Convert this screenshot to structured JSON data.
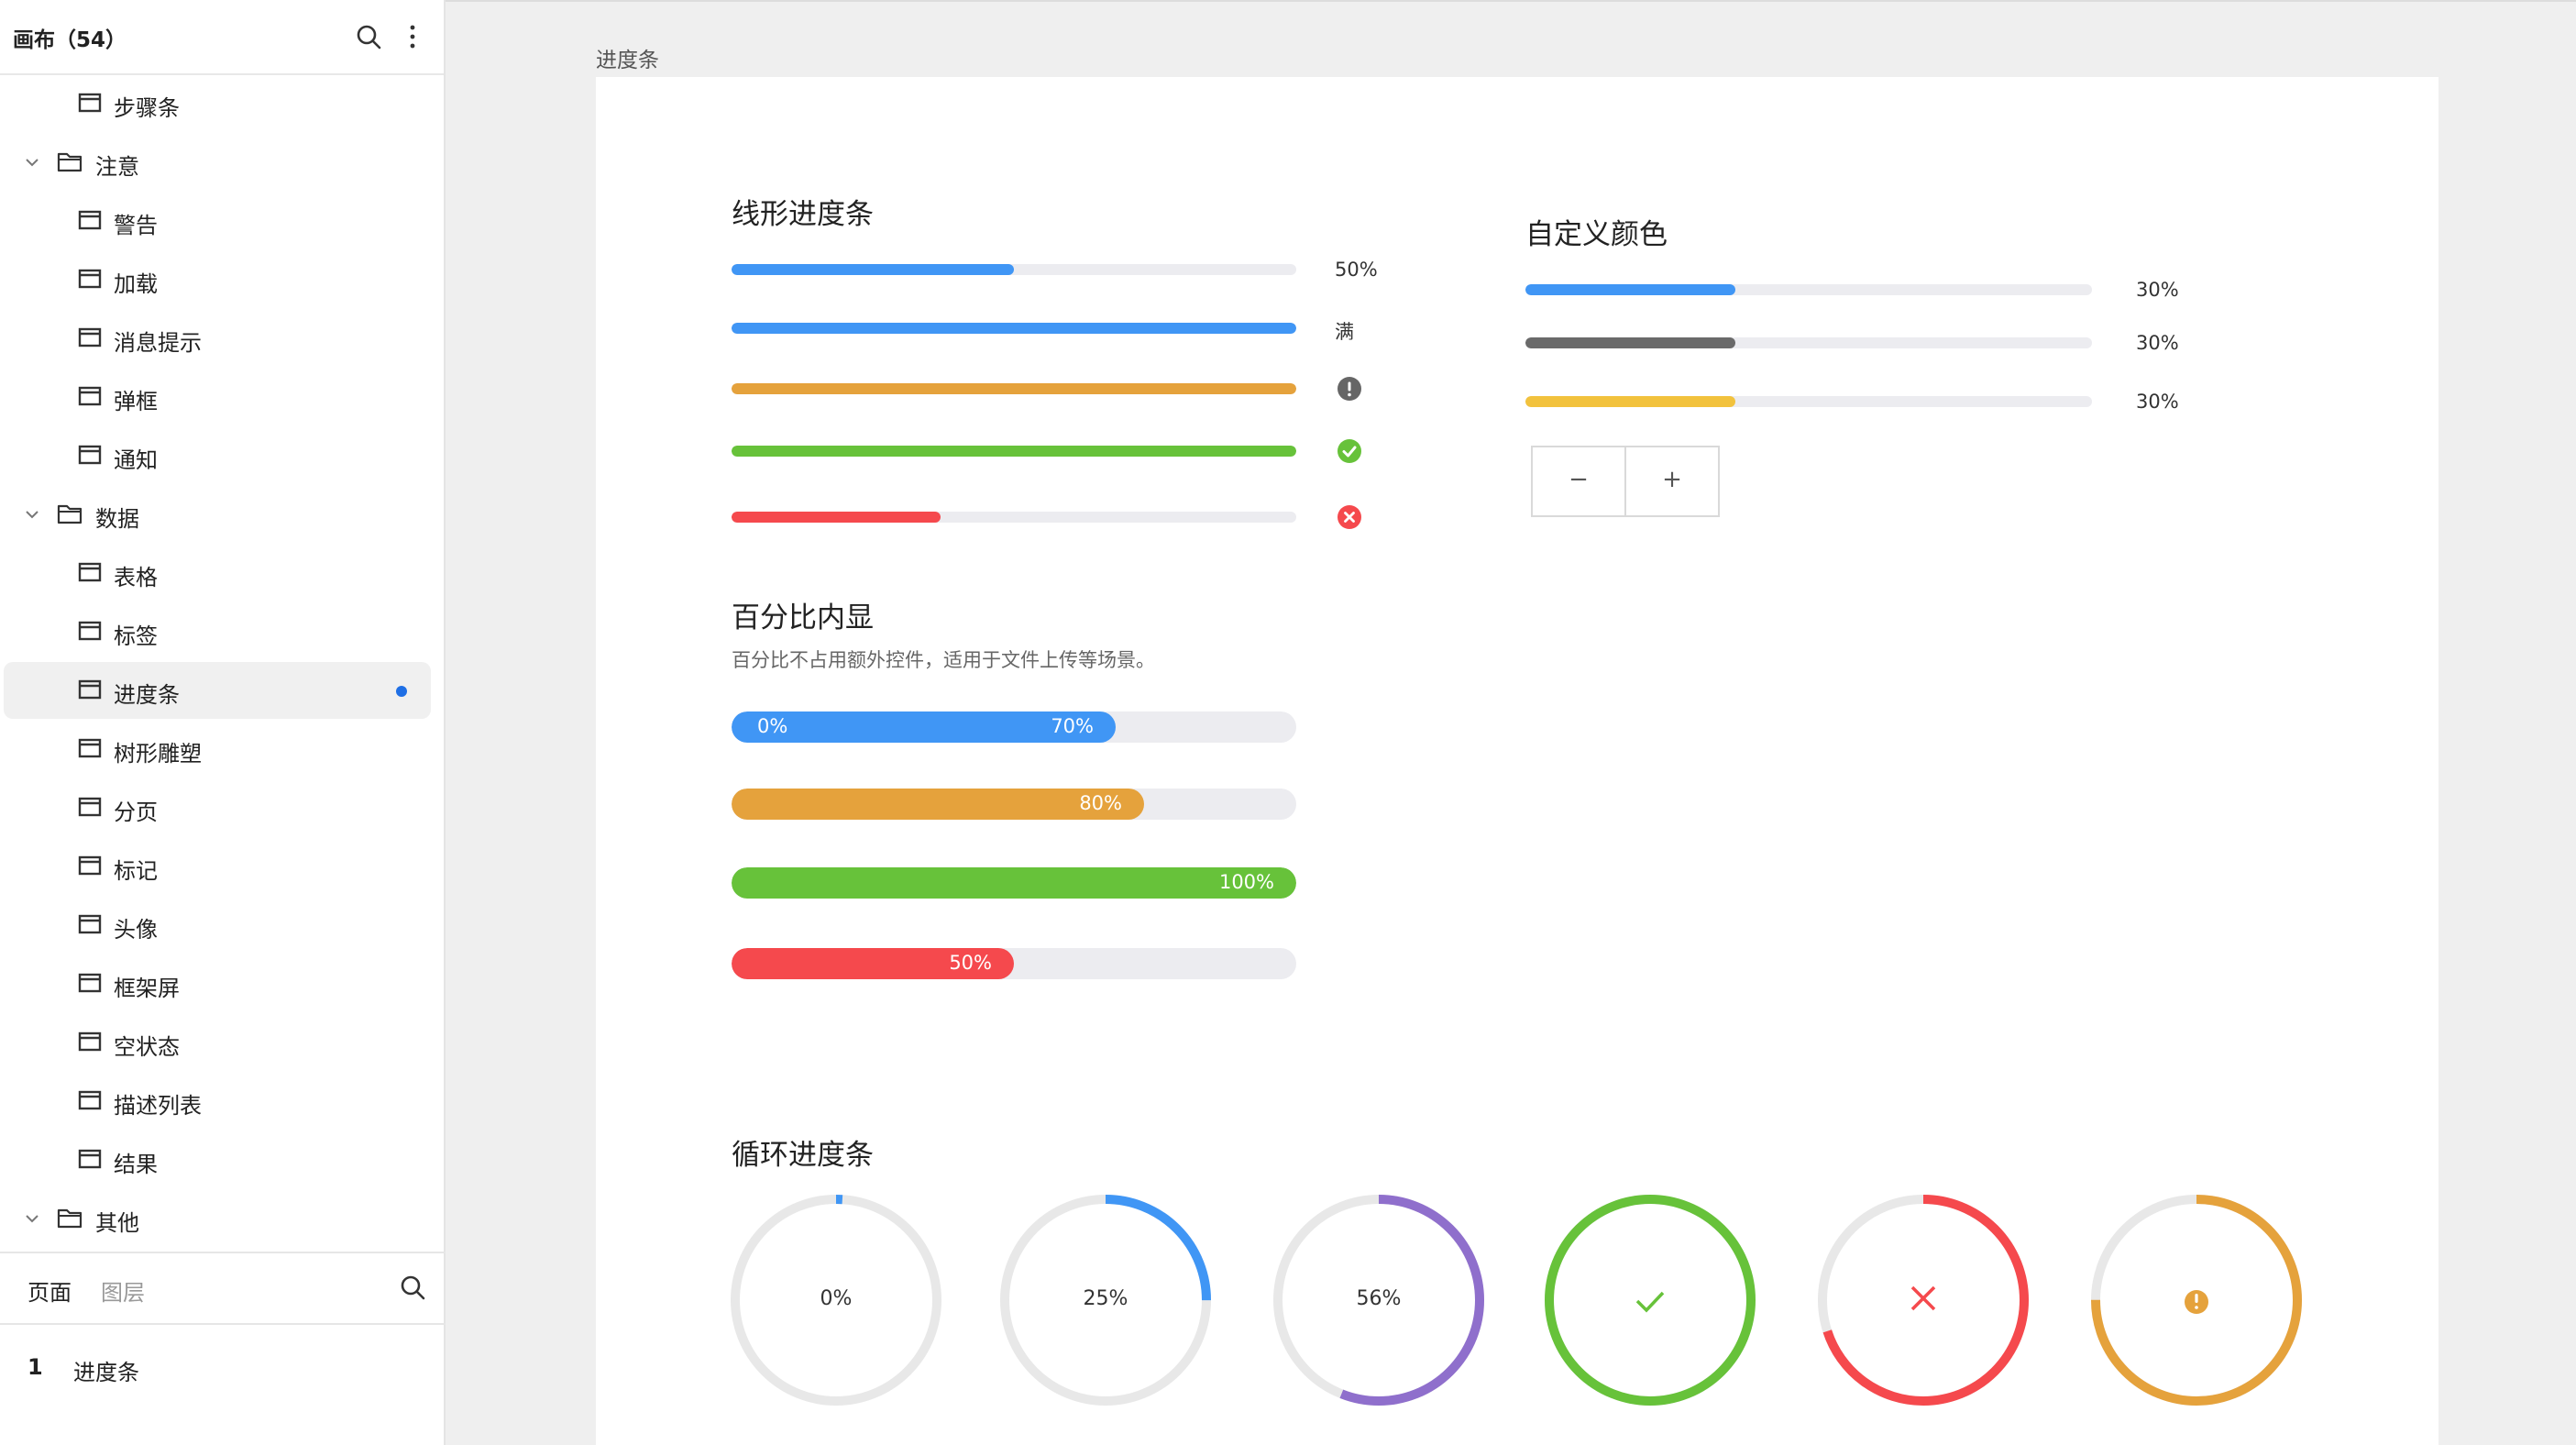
{
  "sidebar": {
    "title": "画布（54）",
    "tree": [
      {
        "label": "步骤条",
        "type": "page"
      },
      {
        "label": "注意",
        "type": "folder"
      },
      {
        "label": "警告",
        "type": "page"
      },
      {
        "label": "加载",
        "type": "page"
      },
      {
        "label": "消息提示",
        "type": "page"
      },
      {
        "label": "弹框",
        "type": "page"
      },
      {
        "label": "通知",
        "type": "page"
      },
      {
        "label": "数据",
        "type": "folder"
      },
      {
        "label": "表格",
        "type": "page"
      },
      {
        "label": "标签",
        "type": "page"
      },
      {
        "label": "进度条",
        "type": "page",
        "selected": true
      },
      {
        "label": "树形雕塑",
        "type": "page"
      },
      {
        "label": "分页",
        "type": "page"
      },
      {
        "label": "标记",
        "type": "page"
      },
      {
        "label": "头像",
        "type": "page"
      },
      {
        "label": "框架屏",
        "type": "page"
      },
      {
        "label": "空状态",
        "type": "page"
      },
      {
        "label": "描述列表",
        "type": "page"
      },
      {
        "label": "结果",
        "type": "page"
      },
      {
        "label": "其他",
        "type": "folder"
      }
    ],
    "tabs": {
      "pages": "页面",
      "layers": "图层"
    },
    "page_list": [
      {
        "num": "1",
        "name": "进度条"
      }
    ],
    "selected_dot_color": "#1f6fe5"
  },
  "canvas": {
    "frame_label": "进度条",
    "linear": {
      "title": "线形进度条",
      "bars": [
        {
          "percent": 50,
          "color": "#4096f5",
          "label": "50%",
          "status": "text"
        },
        {
          "percent": 100,
          "color": "#4096f5",
          "label": "满",
          "status": "text"
        },
        {
          "percent": 100,
          "color": "#e5a23c",
          "label": "",
          "status": "warning-icon"
        },
        {
          "percent": 100,
          "color": "#67c23a",
          "label": "",
          "status": "success-icon"
        },
        {
          "percent": 37,
          "color": "#f5494d",
          "label": "",
          "status": "error-icon"
        }
      ]
    },
    "custom": {
      "title": "自定义颜色",
      "bars": [
        {
          "percent": 37,
          "color": "#4096f5",
          "label": "30%"
        },
        {
          "percent": 37,
          "color": "#6a6a6a",
          "label": "30%"
        },
        {
          "percent": 37,
          "color": "#f2c23d",
          "label": "30%"
        }
      ],
      "stepper": {
        "minus": "−",
        "plus": "+"
      }
    },
    "inner": {
      "title": "百分比内显",
      "desc": "百分比不占用额外控件，适用于文件上传等场景。",
      "bars": [
        {
          "percent": 68,
          "color": "#4096f5",
          "start_label": "0%",
          "label": "70%"
        },
        {
          "percent": 73,
          "color": "#e5a23c",
          "label": "80%"
        },
        {
          "percent": 100,
          "color": "#67c23a",
          "label": "100%"
        },
        {
          "percent": 50,
          "color": "#f5494d",
          "label": "50%"
        }
      ]
    },
    "circular": {
      "title": "循环进度条",
      "items": [
        {
          "percent": 1,
          "color": "#4096f5",
          "label": "0%",
          "icon": "none"
        },
        {
          "percent": 25,
          "color": "#4096f5",
          "label": "25%",
          "icon": "none"
        },
        {
          "percent": 56,
          "color": "#8f6fcc",
          "label": "56%",
          "icon": "none"
        },
        {
          "percent": 100,
          "color": "#67c23a",
          "label": "",
          "icon": "check-icon"
        },
        {
          "percent": 70,
          "color": "#f5494d",
          "label": "",
          "icon": "close-icon"
        },
        {
          "percent": 75,
          "color": "#e5a23c",
          "label": "",
          "icon": "warning-icon"
        }
      ],
      "track_color": "#e8e8e8"
    }
  }
}
